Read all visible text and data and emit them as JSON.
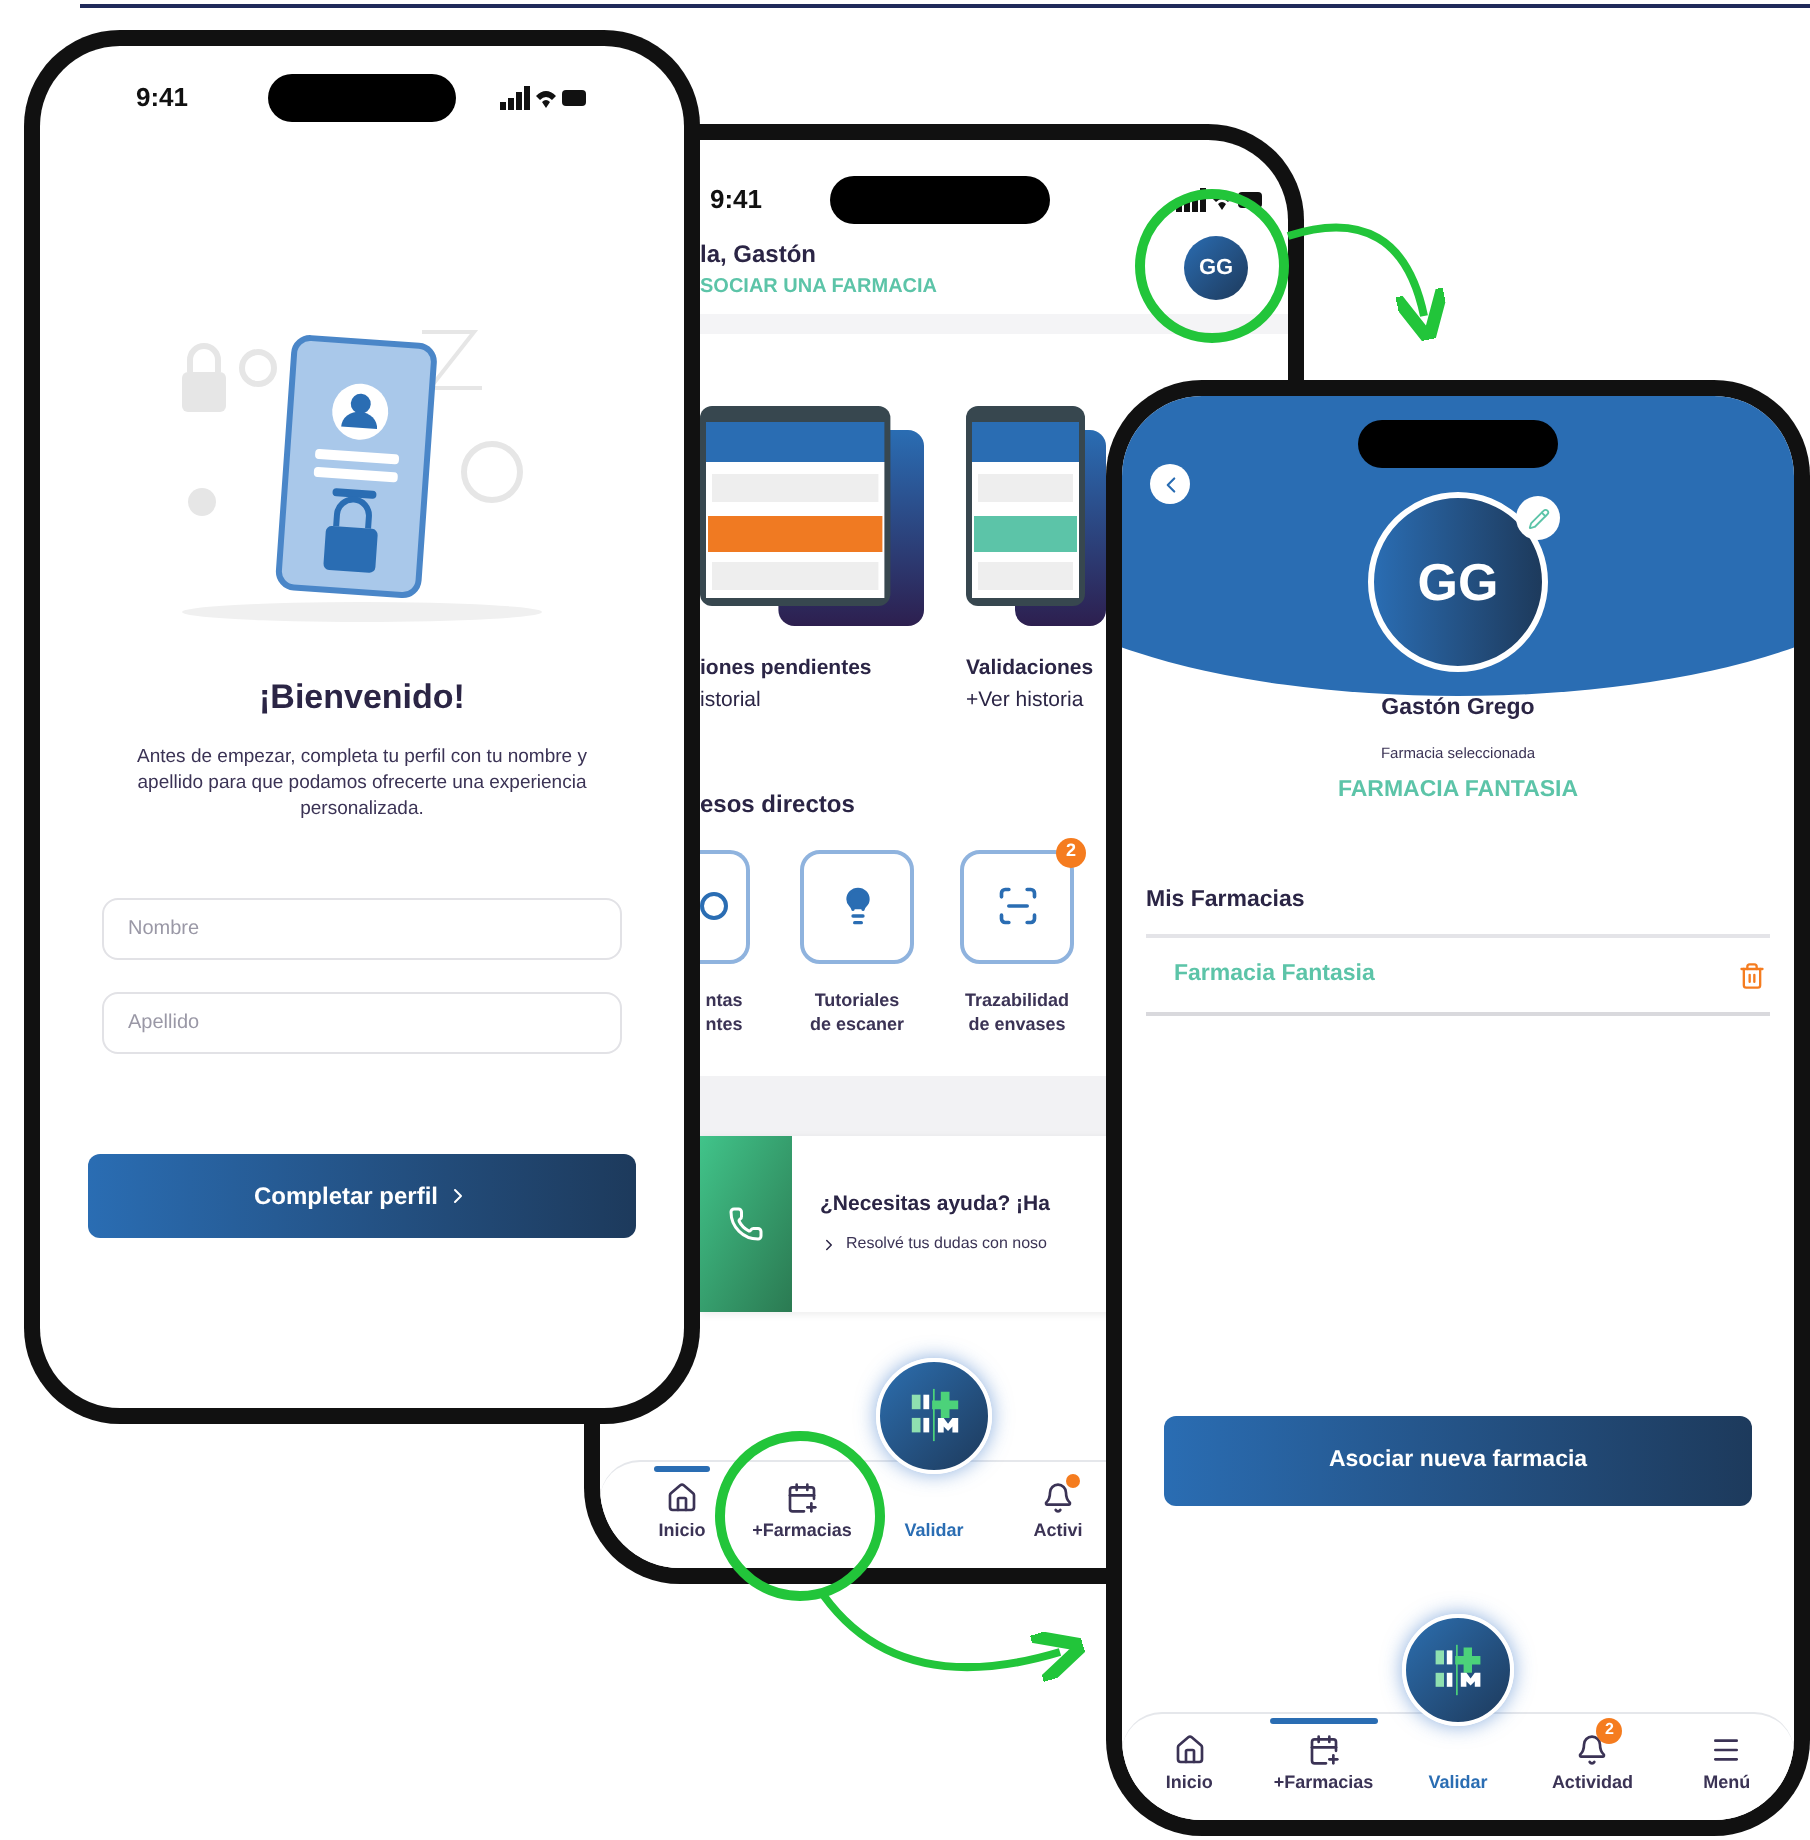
{
  "welcome_phone": {
    "status_time": "9:41",
    "title": "¡Bienvenido!",
    "description": "Antes de empezar, completa tu perfil con tu nombre y apellido para que podamos ofrecerte una experiencia personalizada.",
    "fields": [
      {
        "placeholder": "Nombre"
      },
      {
        "placeholder": "Apellido"
      }
    ],
    "button": "Completar perfil"
  },
  "home_phone": {
    "status_time": "9:41",
    "greeting": "la, Gastón",
    "link": "SOCIAR UNA FARMACIA",
    "avatar": "GG",
    "cards": [
      {
        "title": "iones pendientes",
        "link": "istorial",
        "color": "#f07a22"
      },
      {
        "title": "Validaciones",
        "link": "+Ver historia",
        "color": "#5cc4a8"
      }
    ],
    "section_title": "esos directos",
    "shortcuts": [
      {
        "kind": "partial",
        "lines": [
          "ntas",
          "ntes"
        ]
      },
      {
        "kind": "bulb",
        "lines": [
          "Tutoriales",
          "de escaner"
        ]
      },
      {
        "kind": "qr",
        "lines": [
          "Trazabilidad",
          "de envases"
        ],
        "badge": "2"
      }
    ],
    "help": {
      "title": "¿Necesitas ayuda? ¡Ha",
      "subtitle": "Resolvé tus dudas con noso"
    },
    "nav": [
      {
        "kind": "home",
        "label": "Inicio",
        "selected": true
      },
      {
        "kind": "store",
        "label": "+Farmacias",
        "selected": false
      },
      {
        "kind": "fab",
        "label": "Validar",
        "selected": false
      },
      {
        "kind": "bell",
        "label": "Activi",
        "selected": false,
        "dot": true
      }
    ]
  },
  "profile_phone": {
    "avatar": "GG",
    "name": "Gastón Grego",
    "selected_label": "Farmacia seleccionada",
    "selected_pharmacy": "FARMACIA FANTASIA",
    "list_title": "Mis Farmacias",
    "pharmacies": [
      {
        "name": "Farmacia Fantasia"
      }
    ],
    "button": "Asociar nueva farmacia",
    "nav": [
      {
        "kind": "home",
        "label": "Inicio",
        "selected": false
      },
      {
        "kind": "store",
        "label": "+Farmacias",
        "selected": true
      },
      {
        "kind": "fab",
        "label": "Validar",
        "selected": false
      },
      {
        "kind": "bell",
        "label": "Actividad",
        "selected": false,
        "badge": "2"
      },
      {
        "kind": "menu",
        "label": "Menú",
        "selected": false
      }
    ]
  }
}
